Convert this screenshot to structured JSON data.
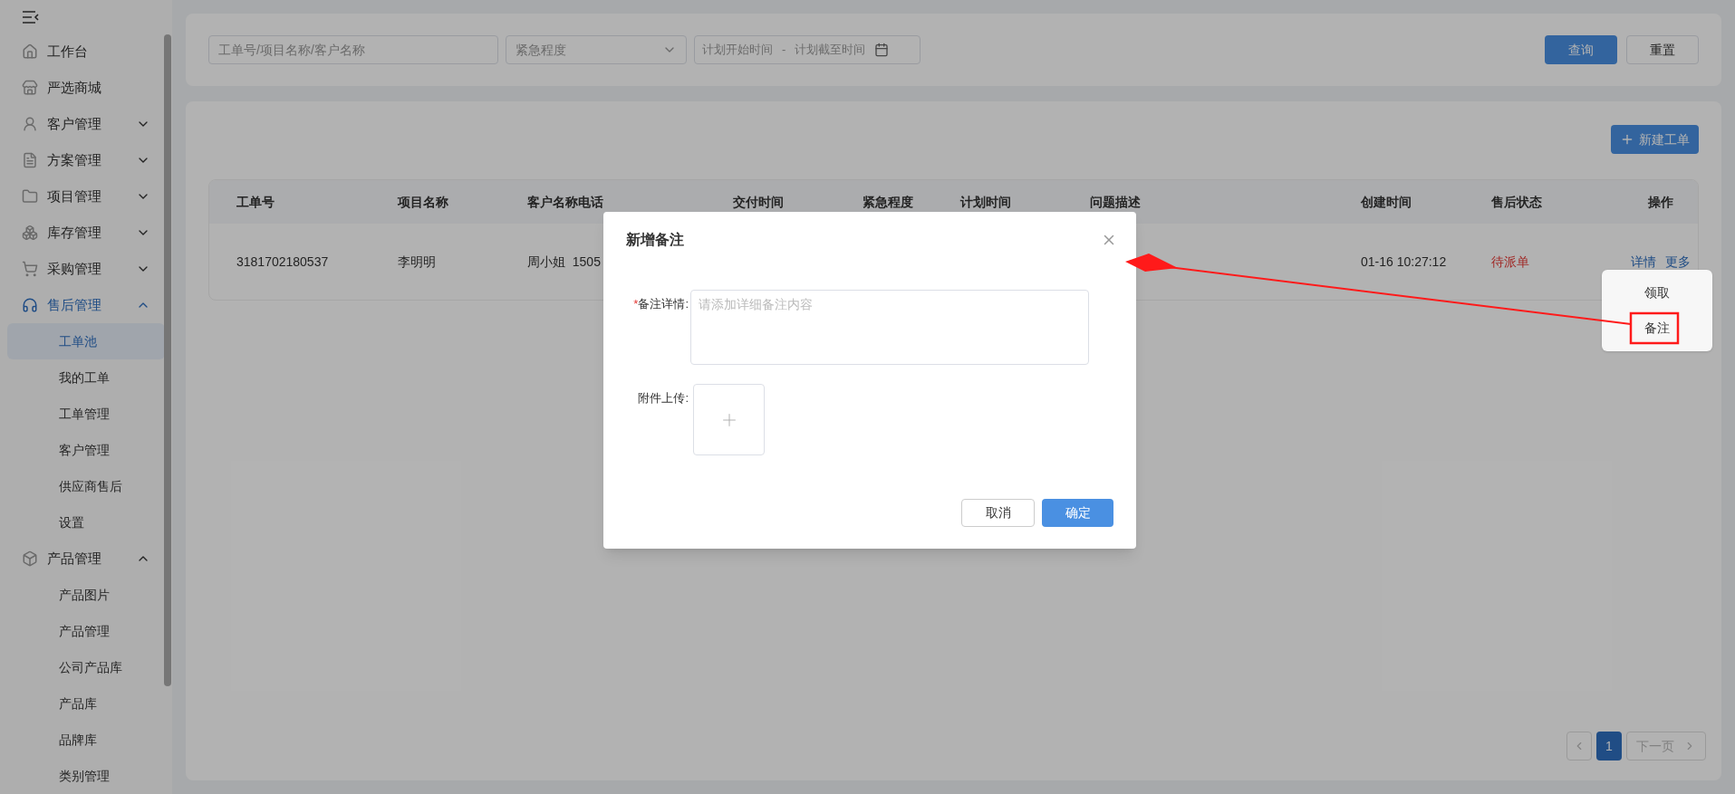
{
  "sidebar": {
    "items": [
      {
        "label": "工作台",
        "selected": false
      },
      {
        "label": "严选商城",
        "selected": false
      },
      {
        "label": "客户管理",
        "selected": false,
        "expanded": false
      },
      {
        "label": "方案管理",
        "selected": false,
        "expanded": false
      },
      {
        "label": "项目管理",
        "selected": false,
        "expanded": false
      },
      {
        "label": "库存管理",
        "selected": false,
        "expanded": false
      },
      {
        "label": "采购管理",
        "selected": false,
        "expanded": false
      },
      {
        "label": "售后管理",
        "selected": true,
        "expanded": true,
        "children": [
          {
            "label": "工单池",
            "selected": true
          },
          {
            "label": "我的工单",
            "selected": false
          },
          {
            "label": "工单管理",
            "selected": false
          },
          {
            "label": "客户管理",
            "selected": false
          },
          {
            "label": "供应商售后",
            "selected": false
          },
          {
            "label": "设置",
            "selected": false
          }
        ]
      },
      {
        "label": "产品管理",
        "selected": false,
        "expanded": true,
        "children": [
          {
            "label": "产品图片",
            "selected": false
          },
          {
            "label": "产品管理",
            "selected": false
          },
          {
            "label": "公司产品库",
            "selected": false
          },
          {
            "label": "产品库",
            "selected": false
          },
          {
            "label": "品牌库",
            "selected": false
          },
          {
            "label": "类别管理",
            "selected": false
          }
        ]
      }
    ]
  },
  "filters": {
    "search": {
      "placeholder": "工单号/项目名称/客户名称"
    },
    "urgency": {
      "placeholder": "紧急程度"
    },
    "date_range": {
      "start_placeholder": "计划开始时间",
      "separator": "-",
      "end_placeholder": "计划截至时间"
    },
    "query_button": "查询",
    "reset_button": "重置"
  },
  "new_button": "新建工单",
  "table": {
    "columns": [
      "工单号",
      "项目名称",
      "客户名称电话",
      "交付时间",
      "紧急程度",
      "计划时间",
      "问题描述",
      "创建时间",
      "售后状态",
      "操作"
    ],
    "rows": [
      {
        "order_no": "3181702180537",
        "project": "李明明",
        "customer": "周小姐  1505",
        "created": "01-16 10:27:12",
        "status": "待派单",
        "actions": [
          "详情",
          "更多"
        ]
      }
    ]
  },
  "more_menu": [
    "领取",
    "备注"
  ],
  "pagination": {
    "pages": [
      {
        "label": "1",
        "selected": true
      }
    ],
    "next": "下一页"
  },
  "dialog": {
    "title": "新增备注",
    "required_mark": "*",
    "fields": [
      {
        "kind": "textarea",
        "required": true,
        "label": "备注详情:",
        "placeholder": "请添加详细备注内容"
      },
      {
        "kind": "upload",
        "required": false,
        "label": "附件上传:"
      }
    ],
    "cancel": "取消",
    "confirm": "确定"
  }
}
